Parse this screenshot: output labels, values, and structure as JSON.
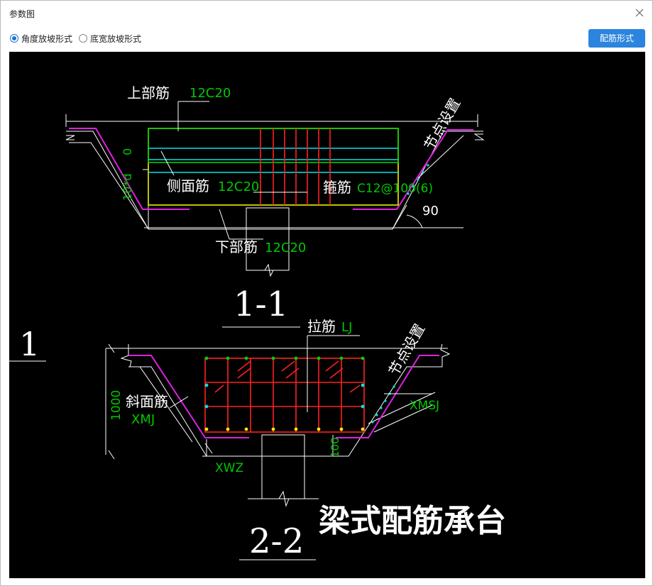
{
  "window": {
    "title": "参数图"
  },
  "options": {
    "angle_label": "角度放坡形式",
    "width_label": "底宽放坡形式",
    "selected": "angle"
  },
  "toolbar": {
    "rebar_form_label": "配筋形式"
  },
  "drawing": {
    "section1": {
      "top_label": "上部筋",
      "top_value": "12C20",
      "side_label": "侧面筋",
      "side_value": "12C20",
      "stirrup_label": "箍筋",
      "stirrup_value": "C12@100(6)",
      "bottom_label": "下部筋",
      "bottom_value": "12C20",
      "node_label": "节点设置",
      "dim_top": "0",
      "dim_side": "10*d",
      "angle": "90",
      "section_title": "1-1"
    },
    "marker": "1",
    "section2": {
      "tie_label": "拉筋",
      "tie_value": "LJ",
      "slope_label": "斜面筋",
      "slope_value": "XMJ",
      "height_dim": "1000",
      "node_label": "节点设置",
      "xmsj": "XMSJ",
      "xwz": "XWZ",
      "dim_100": "100",
      "section_title": "2-2"
    },
    "caption": "梁式配筋承台"
  },
  "colors": {
    "accent": "#2b84dd",
    "background": "#000000",
    "green_text": "#00c800",
    "white_line": "#ffffff",
    "magenta": "#e020e0",
    "red": "#ff2020",
    "cyan": "#00e5e5",
    "yellow": "#f0f000",
    "green_line": "#00d000"
  }
}
